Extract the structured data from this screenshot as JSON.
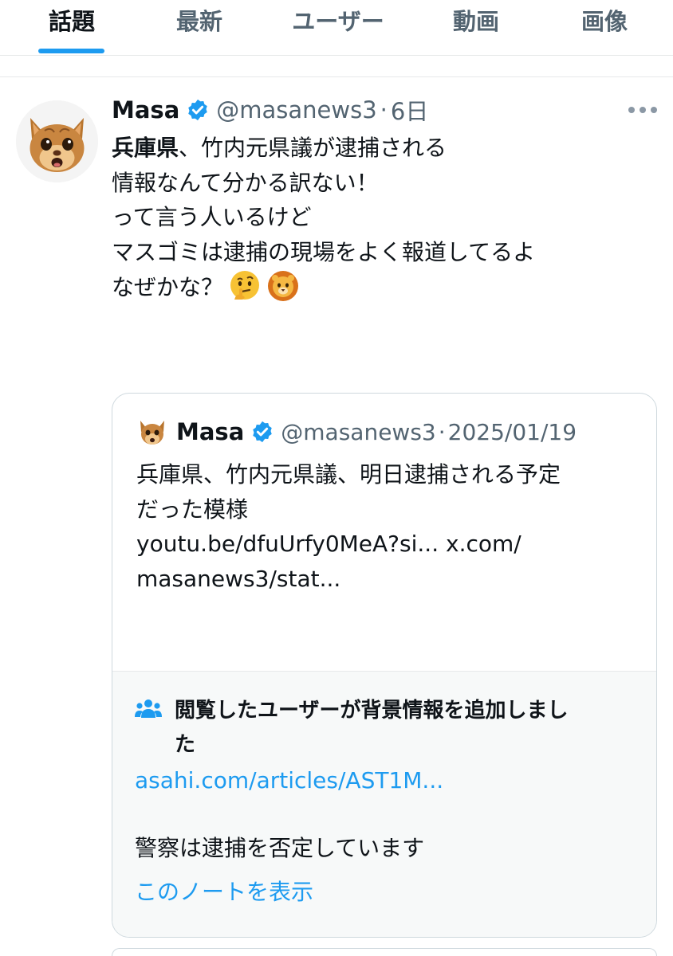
{
  "tabs": [
    {
      "label": "話題",
      "active": true
    },
    {
      "label": "最新",
      "active": false
    },
    {
      "label": "ユーザー",
      "active": false
    },
    {
      "label": "動画",
      "active": false
    },
    {
      "label": "画像",
      "active": false
    }
  ],
  "tweet": {
    "avatar_icon": "cat-avatar-icon",
    "display_name": "Masa",
    "handle": "@masanews3",
    "separator": "·",
    "time": "6日",
    "body": {
      "line1_bold": "兵庫県",
      "line1_rest": "、竹内元県議が逮捕される",
      "line2": "情報なんて分かる訳ない！",
      "line3": "って言う人いるけど",
      "line4": "マスゴミは逮捕の現場をよく報道してるよ",
      "line5": "なぜかな？",
      "emojis": [
        "thinking-face-icon",
        "lion-face-icon"
      ]
    },
    "quote": {
      "display_name": "Masa",
      "handle": "@masanews3",
      "separator": "·",
      "time": "2025/01/19",
      "line1": "兵庫県、竹内元県議、明日逮捕される予定",
      "line2": "だった模様",
      "line3": "youtu.be/dfuUrfy0MeA?si... x.com/",
      "line4": "masanews3/stat...",
      "community_note": {
        "title_line1": "閲覧したユーザーが背景情報を追加しまし",
        "title_line2": "た",
        "link": "asahi.com/articles/AST1M...",
        "text": "警察は逮捕を否定しています",
        "show_note": "このノートを表示"
      }
    }
  },
  "colors": {
    "accent": "#1d9bf0",
    "text_primary": "#0f1419",
    "text_secondary": "#536471",
    "border": "#cfd9de",
    "note_background": "#f7f9f9"
  }
}
